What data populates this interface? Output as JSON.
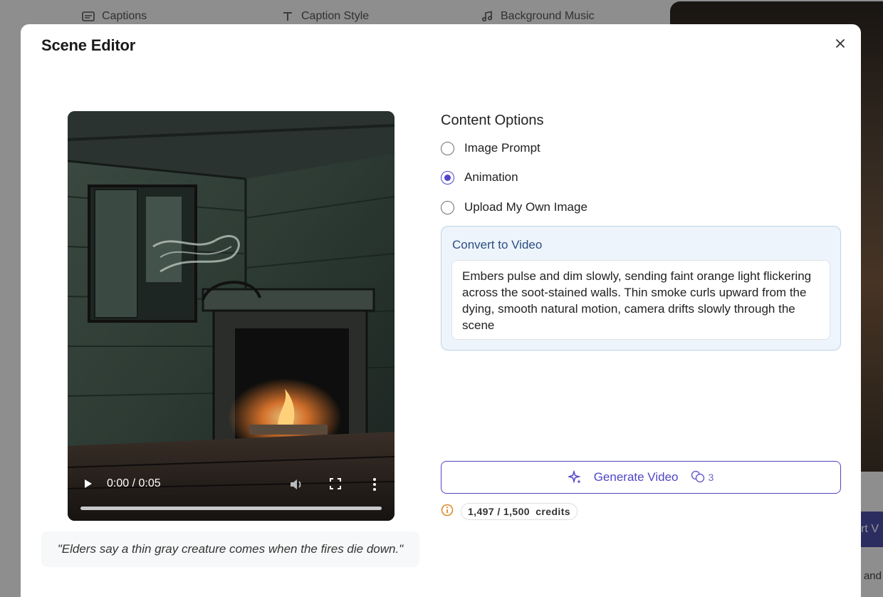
{
  "background": {
    "tabs": [
      {
        "label": "Captions",
        "icon": "captions-icon"
      },
      {
        "label": "Caption Style",
        "icon": "text-icon"
      },
      {
        "label": "Background Music",
        "icon": "music-note-icon"
      }
    ],
    "right_button_text": "ort V",
    "right_text": "you and"
  },
  "modal": {
    "title": "Scene Editor",
    "close_icon": "close-icon"
  },
  "video": {
    "time": "0:00 / 0:05",
    "progress_fraction": 0.0,
    "caption_quote": "\"Elders say a thin gray creature comes when the fires die down.\""
  },
  "content_options": {
    "title": "Content Options",
    "options": [
      {
        "label": "Image Prompt",
        "selected": false
      },
      {
        "label": "Animation",
        "selected": true
      },
      {
        "label": "Upload My Own Image",
        "selected": false
      }
    ]
  },
  "convert": {
    "title": "Convert to Video",
    "prompt": "Embers pulse and dim slowly, sending faint orange light flickering across the soot-stained walls. Thin smoke curls upward from the dying, smooth natural motion, camera drifts slowly through the scene"
  },
  "generate": {
    "label": "Generate Video",
    "cost": "3"
  },
  "credits": {
    "used": "1,497 / 1,500",
    "unit": "credits"
  },
  "colors": {
    "accent": "#4f46c9",
    "convert_bg": "#eef4fb",
    "warning": "#e08a2b"
  }
}
